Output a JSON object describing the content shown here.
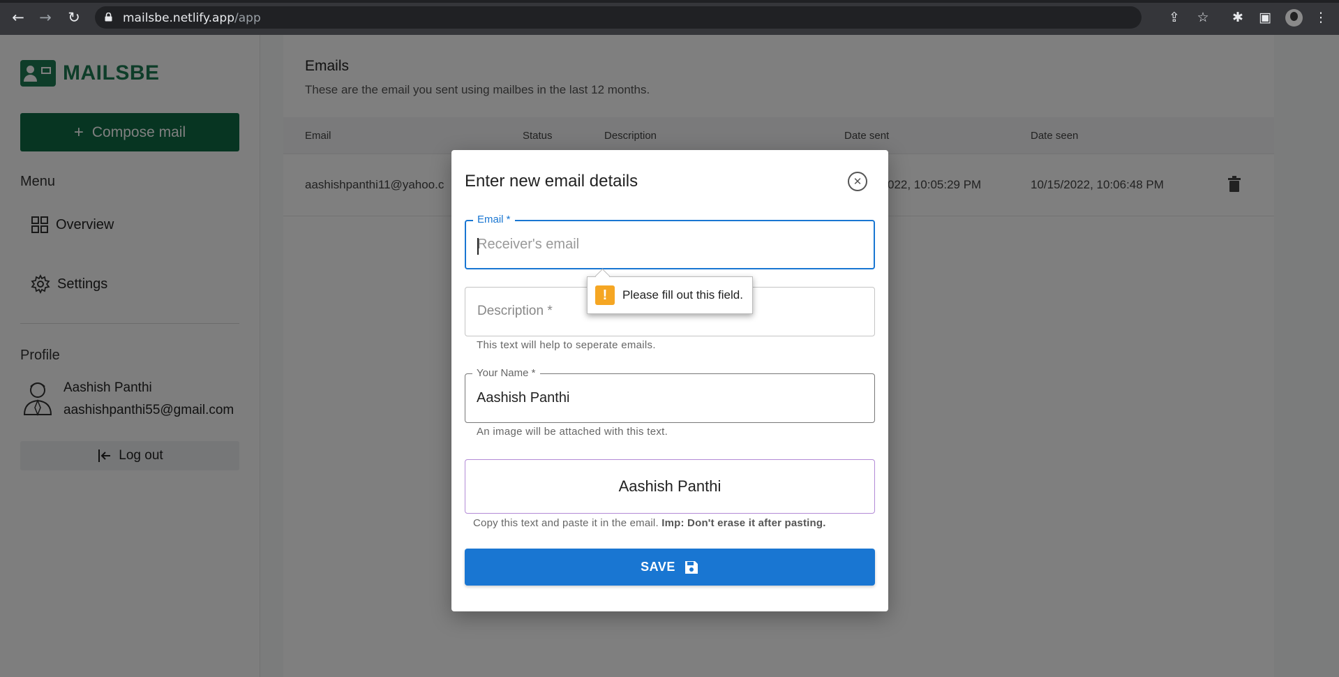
{
  "browser": {
    "url_host": "mailsbe.netlify.app",
    "url_path": "/app",
    "icons": [
      "back-arrow-icon",
      "forward-arrow-icon",
      "reload-icon",
      "lock-icon",
      "share-icon",
      "star-icon",
      "extensions-icon",
      "side-panel-icon",
      "profile-avatar-icon",
      "kebab-menu-icon"
    ]
  },
  "sidebar": {
    "logo_text": "MAILSBE",
    "compose_label": "Compose mail",
    "menu_label": "Menu",
    "items": [
      {
        "label": "Overview",
        "icon": "grid-icon"
      },
      {
        "label": "Settings",
        "icon": "gear-icon"
      }
    ],
    "profile_label": "Profile",
    "profile_name": "Aashish Panthi",
    "profile_email": "aashishpanthi55@gmail.com",
    "logout_label": "Log out"
  },
  "main": {
    "title": "Emails",
    "subtitle": "These are the email you sent using mailbes in the last 12 months.",
    "columns": [
      "Email",
      "Status",
      "Description",
      "Date sent",
      "Date seen"
    ],
    "rows": [
      {
        "email": "aashishpanthi11@yahoo.c",
        "date_sent": "022, 10:05:29 PM",
        "date_seen": "10/15/2022, 10:06:48 PM"
      }
    ]
  },
  "modal": {
    "title": "Enter new email details",
    "email_label": "Email *",
    "email_placeholder": "Receiver's email",
    "email_value": "",
    "description_label": "Description *",
    "description_helper": "This text will help to seperate emails.",
    "name_label": "Your Name *",
    "name_value": "Aashish Panthi",
    "name_helper": "An image will be attached with this text.",
    "signature_text": "Aashish Panthi",
    "copy_note": "Copy this text and paste it in the email.",
    "copy_note_bold": "Imp: Don't erase it after pasting.",
    "save_label": "SAVE",
    "validation_tooltip": "Please fill out this field."
  },
  "colors": {
    "brand_green": "#1d7a52",
    "compose_green": "#0f6b45",
    "primary_blue": "#1976d2",
    "warning_orange": "#f5a623"
  }
}
